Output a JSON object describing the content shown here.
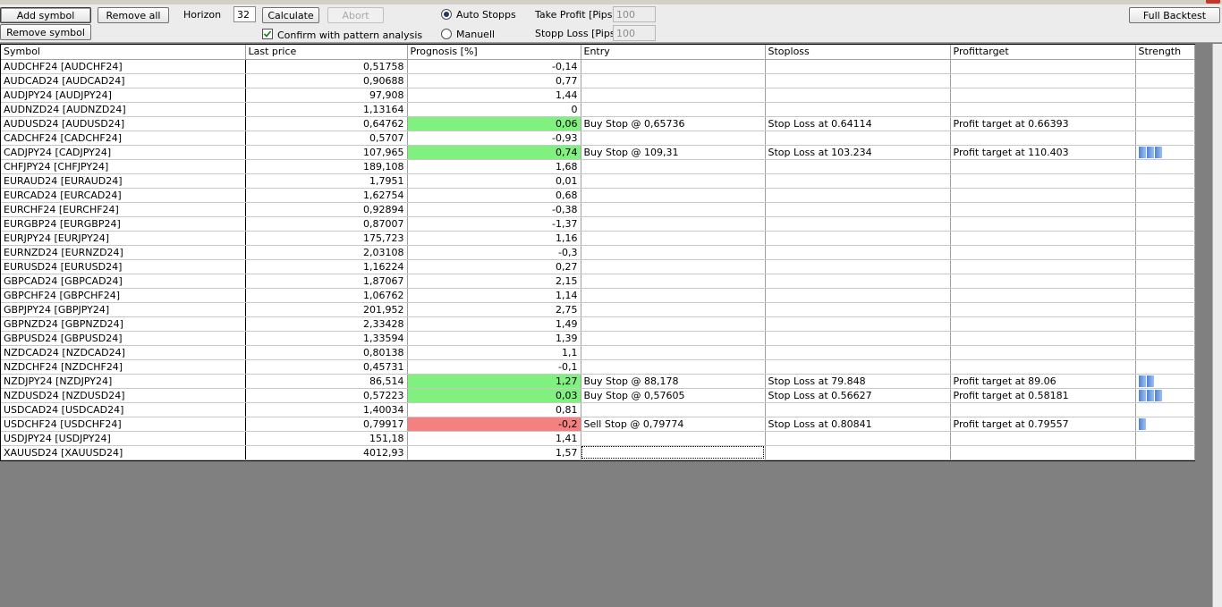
{
  "toolbar": {
    "add_symbol": "Add symbol",
    "remove_symbol": "Remove symbol",
    "remove_all": "Remove all",
    "horizon_label": "Horizon",
    "horizon_value": "32",
    "calculate": "Calculate",
    "abort": "Abort",
    "confirm_pattern": "Confirm with pattern analysis",
    "confirm_pattern_checked": true,
    "auto_stopps": "Auto Stopps",
    "manuell": "Manuell",
    "stop_mode_selected": "Auto Stopps",
    "take_profit_label": "Take Profit [Pips]",
    "take_profit_value": "100",
    "stopp_loss_label": "Stopp Loss [Pips]",
    "stopp_loss_value": "100",
    "full_backtest": "Full Backtest"
  },
  "grid": {
    "columns": [
      "Symbol",
      "Last price",
      "Prognosis [%]",
      "Entry",
      "Stoploss",
      "Profittarget",
      "Strength"
    ],
    "rows": [
      {
        "symbol": "AUDCHF24 [AUDCHF24]",
        "price": "0,51758",
        "prognosis": "-0,14",
        "highlight": "",
        "entry": "",
        "stoploss": "",
        "target": "",
        "strength": 0
      },
      {
        "symbol": "AUDCAD24 [AUDCAD24]",
        "price": "0,90688",
        "prognosis": "0,77",
        "highlight": "",
        "entry": "",
        "stoploss": "",
        "target": "",
        "strength": 0
      },
      {
        "symbol": "AUDJPY24 [AUDJPY24]",
        "price": "97,908",
        "prognosis": "1,44",
        "highlight": "",
        "entry": "",
        "stoploss": "",
        "target": "",
        "strength": 0
      },
      {
        "symbol": "AUDNZD24 [AUDNZD24]",
        "price": "1,13164",
        "prognosis": "0",
        "highlight": "",
        "entry": "",
        "stoploss": "",
        "target": "",
        "strength": 0
      },
      {
        "symbol": "AUDUSD24 [AUDUSD24]",
        "price": "0,64762",
        "prognosis": "0,06",
        "highlight": "pos",
        "entry": "Buy Stop @ 0,65736",
        "stoploss": "Stop Loss at 0.64114",
        "target": "Profit target at 0.66393",
        "strength": 0
      },
      {
        "symbol": "CADCHF24 [CADCHF24]",
        "price": "0,5707",
        "prognosis": "-0,93",
        "highlight": "",
        "entry": "",
        "stoploss": "",
        "target": "",
        "strength": 0
      },
      {
        "symbol": "CADJPY24 [CADJPY24]",
        "price": "107,965",
        "prognosis": "0,74",
        "highlight": "pos",
        "entry": "Buy Stop @ 109,31",
        "stoploss": "Stop Loss at 103.234",
        "target": "Profit target at 110.403",
        "strength": 3
      },
      {
        "symbol": "CHFJPY24 [CHFJPY24]",
        "price": "189,108",
        "prognosis": "1,68",
        "highlight": "",
        "entry": "",
        "stoploss": "",
        "target": "",
        "strength": 0
      },
      {
        "symbol": "EURAUD24 [EURAUD24]",
        "price": "1,7951",
        "prognosis": "0,01",
        "highlight": "",
        "entry": "",
        "stoploss": "",
        "target": "",
        "strength": 0
      },
      {
        "symbol": "EURCAD24 [EURCAD24]",
        "price": "1,62754",
        "prognosis": "0,68",
        "highlight": "",
        "entry": "",
        "stoploss": "",
        "target": "",
        "strength": 0
      },
      {
        "symbol": "EURCHF24 [EURCHF24]",
        "price": "0,92894",
        "prognosis": "-0,38",
        "highlight": "",
        "entry": "",
        "stoploss": "",
        "target": "",
        "strength": 0
      },
      {
        "symbol": "EURGBP24 [EURGBP24]",
        "price": "0,87007",
        "prognosis": "-1,37",
        "highlight": "",
        "entry": "",
        "stoploss": "",
        "target": "",
        "strength": 0
      },
      {
        "symbol": "EURJPY24 [EURJPY24]",
        "price": "175,723",
        "prognosis": "1,16",
        "highlight": "",
        "entry": "",
        "stoploss": "",
        "target": "",
        "strength": 0
      },
      {
        "symbol": "EURNZD24 [EURNZD24]",
        "price": "2,03108",
        "prognosis": "-0,3",
        "highlight": "",
        "entry": "",
        "stoploss": "",
        "target": "",
        "strength": 0
      },
      {
        "symbol": "EURUSD24 [EURUSD24]",
        "price": "1,16224",
        "prognosis": "0,27",
        "highlight": "",
        "entry": "",
        "stoploss": "",
        "target": "",
        "strength": 0
      },
      {
        "symbol": "GBPCAD24 [GBPCAD24]",
        "price": "1,87067",
        "prognosis": "2,15",
        "highlight": "",
        "entry": "",
        "stoploss": "",
        "target": "",
        "strength": 0
      },
      {
        "symbol": "GBPCHF24 [GBPCHF24]",
        "price": "1,06762",
        "prognosis": "1,14",
        "highlight": "",
        "entry": "",
        "stoploss": "",
        "target": "",
        "strength": 0
      },
      {
        "symbol": "GBPJPY24 [GBPJPY24]",
        "price": "201,952",
        "prognosis": "2,75",
        "highlight": "",
        "entry": "",
        "stoploss": "",
        "target": "",
        "strength": 0
      },
      {
        "symbol": "GBPNZD24 [GBPNZD24]",
        "price": "2,33428",
        "prognosis": "1,49",
        "highlight": "",
        "entry": "",
        "stoploss": "",
        "target": "",
        "strength": 0
      },
      {
        "symbol": "GBPUSD24 [GBPUSD24]",
        "price": "1,33594",
        "prognosis": "1,39",
        "highlight": "",
        "entry": "",
        "stoploss": "",
        "target": "",
        "strength": 0
      },
      {
        "symbol": "NZDCAD24 [NZDCAD24]",
        "price": "0,80138",
        "prognosis": "1,1",
        "highlight": "",
        "entry": "",
        "stoploss": "",
        "target": "",
        "strength": 0
      },
      {
        "symbol": "NZDCHF24 [NZDCHF24]",
        "price": "0,45731",
        "prognosis": "-0,1",
        "highlight": "",
        "entry": "",
        "stoploss": "",
        "target": "",
        "strength": 0
      },
      {
        "symbol": "NZDJPY24 [NZDJPY24]",
        "price": "86,514",
        "prognosis": "1,27",
        "highlight": "pos",
        "entry": "Buy Stop @ 88,178",
        "stoploss": "Stop Loss at 79.848",
        "target": "Profit target at 89.06",
        "strength": 2
      },
      {
        "symbol": "NZDUSD24 [NZDUSD24]",
        "price": "0,57223",
        "prognosis": "0,03",
        "highlight": "pos",
        "entry": "Buy Stop @ 0,57605",
        "stoploss": "Stop Loss at 0.56627",
        "target": "Profit target at 0.58181",
        "strength": 3
      },
      {
        "symbol": "USDCAD24 [USDCAD24]",
        "price": "1,40034",
        "prognosis": "0,81",
        "highlight": "",
        "entry": "",
        "stoploss": "",
        "target": "",
        "strength": 0
      },
      {
        "symbol": "USDCHF24 [USDCHF24]",
        "price": "0,79917",
        "prognosis": "-0,2",
        "highlight": "neg",
        "entry": "Sell Stop @ 0,79774",
        "stoploss": "Stop Loss at 0.80841",
        "target": "Profit target at 0.79557",
        "strength": 1
      },
      {
        "symbol": "USDJPY24 [USDJPY24]",
        "price": "151,18",
        "prognosis": "1,41",
        "highlight": "",
        "entry": "",
        "stoploss": "",
        "target": "",
        "strength": 0
      },
      {
        "symbol": "XAUUSD24 [XAUUSD24]",
        "price": "4012,93",
        "prognosis": "1,57",
        "highlight": "",
        "entry": "",
        "stoploss": "",
        "target": "",
        "strength": 0
      }
    ]
  },
  "colors": {
    "positive": "#80f07e",
    "negative": "#f58080",
    "strength_bar": "#4d82d6",
    "background": "#808080"
  }
}
